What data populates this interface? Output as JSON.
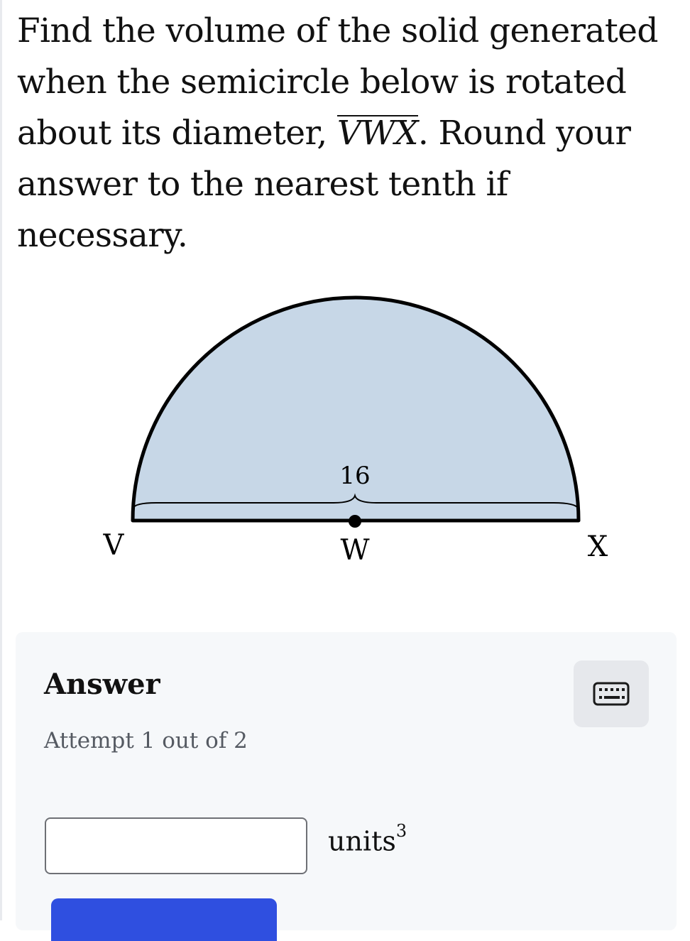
{
  "question": {
    "text_before": "Find the volume of the solid generated when the semicircle below is rotated about its diameter, ",
    "diameter_segment": "VWX",
    "text_after": ". Round your answer to the nearest tenth if necessary."
  },
  "figure": {
    "measure_label": "16",
    "point_left": "V",
    "point_center": "W",
    "point_right": "X",
    "fill_color": "#c7d7e7",
    "stroke_color": "#000000"
  },
  "answer": {
    "title": "Answer",
    "attempt_text": "Attempt 1 out of 2",
    "input_value": "",
    "input_placeholder": "",
    "units_base": "units",
    "units_exponent": "3",
    "keyboard_icon": "keyboard-icon",
    "submit_label": "",
    "accent_color": "#2f4fe0"
  }
}
